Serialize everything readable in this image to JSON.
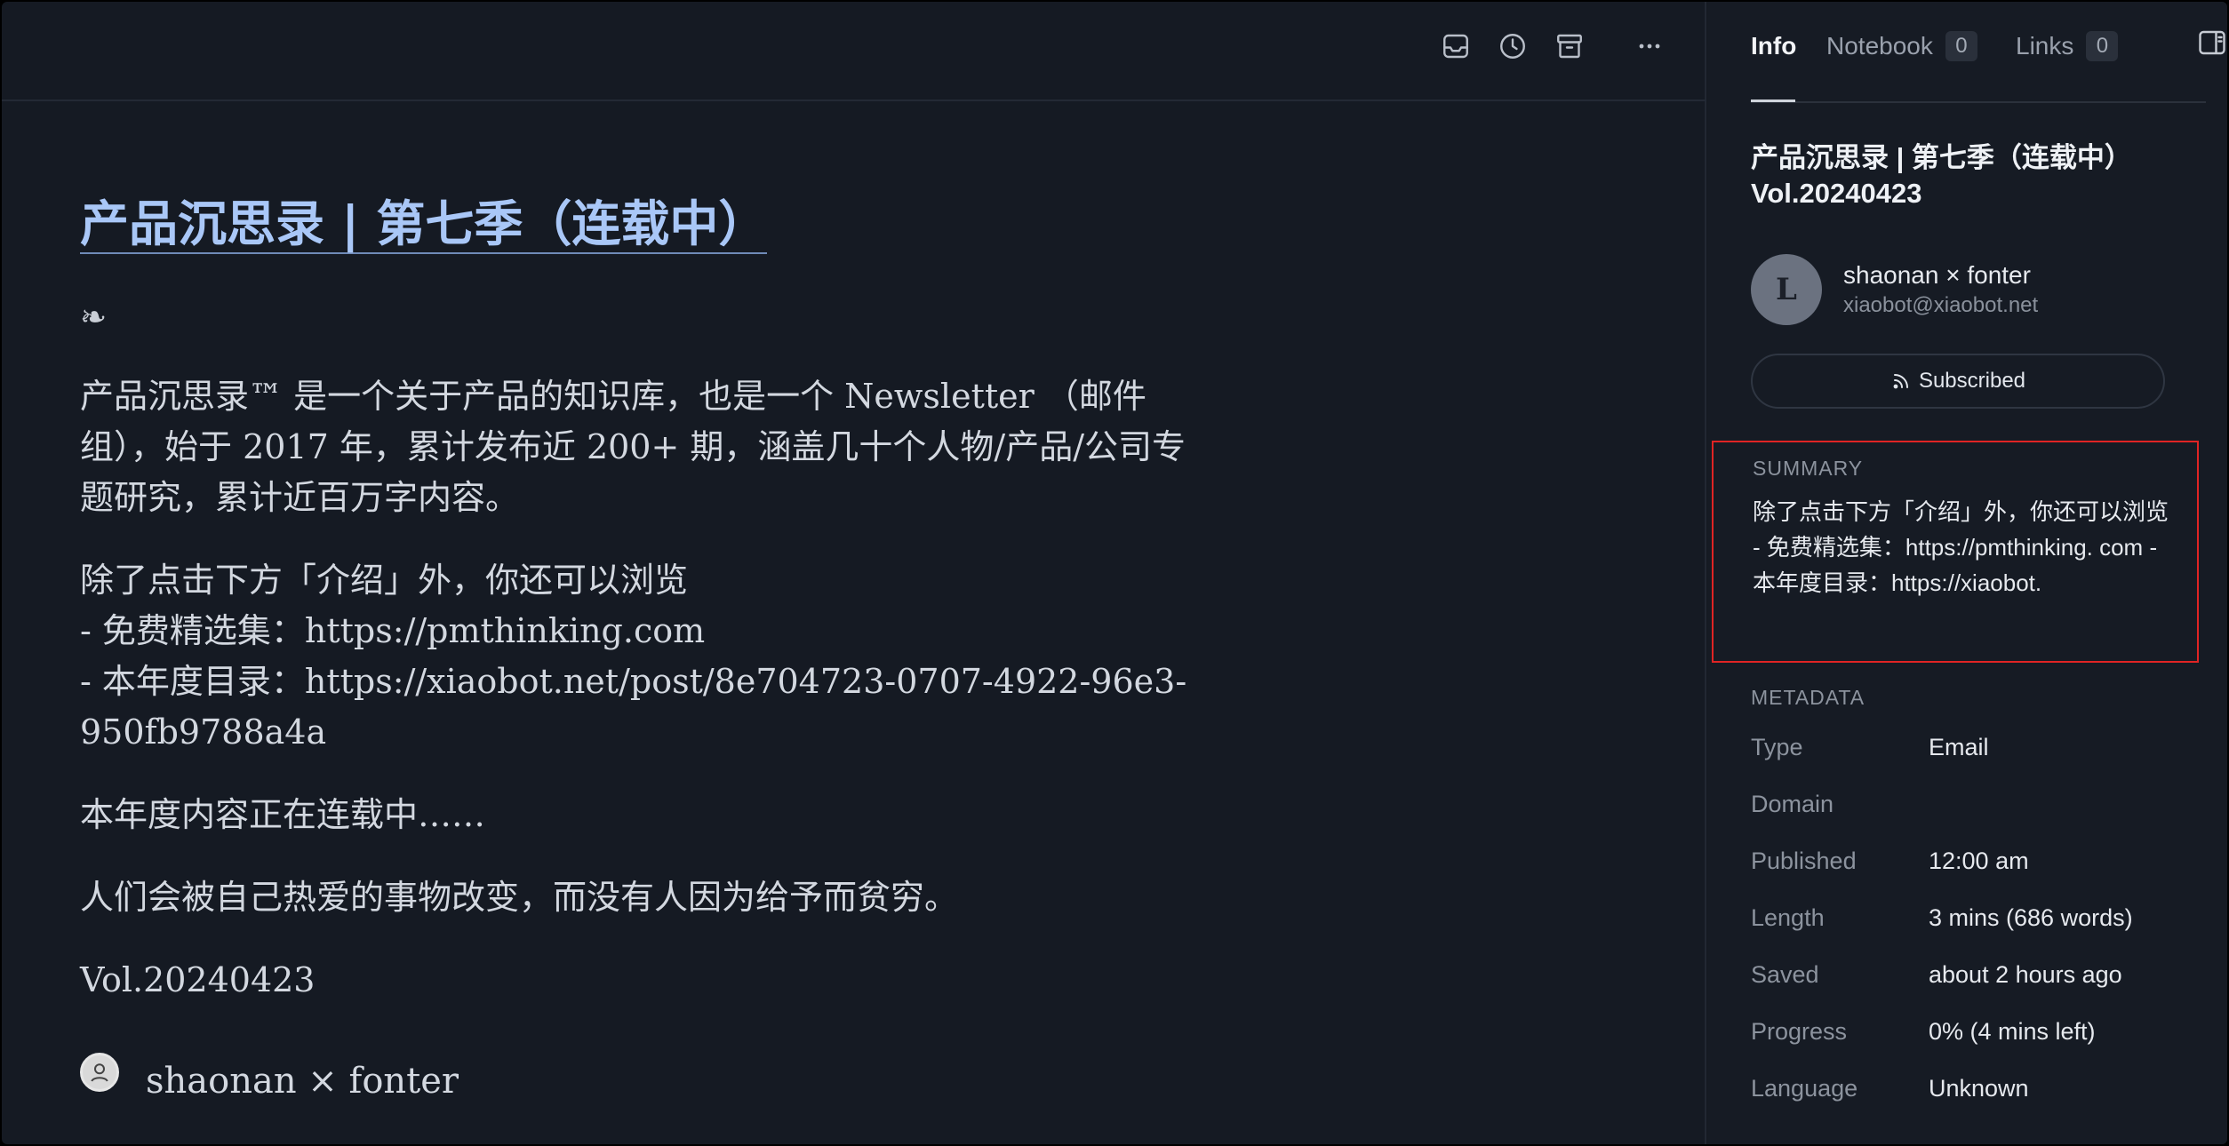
{
  "article": {
    "title": "产品沉思录 | 第七季（连载中）",
    "fleuron": "❧",
    "paragraphs": [
      "产品沉思录™ 是一个关于产品的知识库，也是一个 Newsletter （邮件组），始于 2017 年，累计发布近 200+ 期，涵盖几十个人物/产品/公司专题研究，累计近百万字内容。",
      "除了点击下方「介绍」外，你还可以浏览",
      "- 免费精选集：https://pmthinking.com",
      "- 本年度目录：https://xiaobot.net/post/8e704723-0707-4922-96e3-950fb9788a4a",
      "本年度内容正在连载中……",
      "人们会被自己热爱的事物改变，而没有人因为给予而贫穷。",
      "Vol.20240423"
    ],
    "byline": "shaonan × fonter"
  },
  "toolbar": {
    "icons": [
      "inbox-icon",
      "history-icon",
      "archive-icon",
      "more-icon"
    ]
  },
  "panel": {
    "tabs": [
      {
        "label": "Info",
        "count": null
      },
      {
        "label": "Notebook",
        "count": "0"
      },
      {
        "label": "Links",
        "count": "0"
      }
    ],
    "title_line1": "产品沉思录 | 第七季（连载中）",
    "title_line2": "Vol.20240423",
    "author_initial": "L",
    "author_name": "shaonan × fonter",
    "author_email": "xiaobot@xiaobot.net",
    "subscribe_label": "Subscribed",
    "summary_label": "SUMMARY",
    "summary_text": "除了点击下方「介绍」外，你还可以浏览 - 免费精选集：https://pmthinking. com - 本年度目录：https://xiaobot.",
    "metadata_label": "METADATA",
    "metadata": [
      {
        "key": "Type",
        "value": "Email"
      },
      {
        "key": "Domain",
        "value": ""
      },
      {
        "key": "Published",
        "value": "12:00 am"
      },
      {
        "key": "Length",
        "value": "3 mins (686 words)"
      },
      {
        "key": "Saved",
        "value": "about 2 hours ago"
      },
      {
        "key": "Progress",
        "value": "0% (4 mins left)"
      },
      {
        "key": "Language",
        "value": "Unknown"
      }
    ]
  },
  "colors": {
    "background": "#151a23",
    "title_link": "#a9c7f7",
    "highlight_border": "#e02424"
  }
}
